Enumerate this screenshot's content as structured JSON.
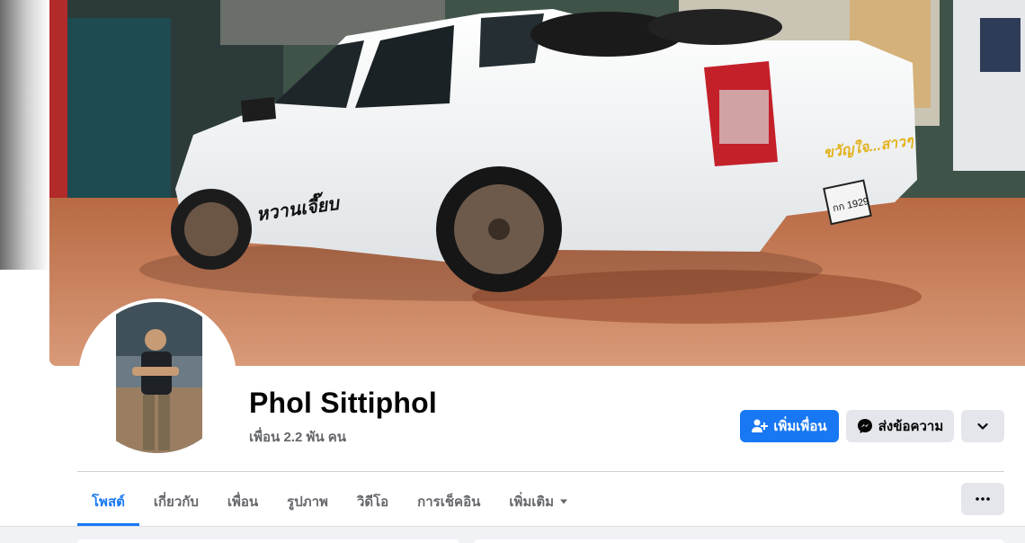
{
  "profile": {
    "name": "Phol Sittiphol",
    "friends_count": "เพื่อน 2.2 พัน คน"
  },
  "actions": {
    "add_friend": "เพิ่มเพื่อน",
    "message": "ส่งข้อความ"
  },
  "tabs": [
    {
      "label": "โพสต์",
      "active": true
    },
    {
      "label": "เกี่ยวกับ",
      "active": false
    },
    {
      "label": "เพื่อน",
      "active": false
    },
    {
      "label": "รูปภาพ",
      "active": false
    },
    {
      "label": "วิดีโอ",
      "active": false
    },
    {
      "label": "การเช็คอิน",
      "active": false
    },
    {
      "label": "เพิ่มเติม",
      "active": false
    }
  ],
  "cover": {
    "sticker_side": "หวานเจี๊ยบ",
    "sticker_tail": "ขวัญใจ...สาวๆ",
    "plate": "กก 1929"
  },
  "icons": {
    "add_friend": "person-plus-icon",
    "message": "messenger-icon",
    "more": "chevron-down-icon",
    "tab_more": "caret-down-icon",
    "dots": "ellipsis-icon"
  },
  "colors": {
    "accent": "#1877f2",
    "secondary_bg": "#e4e6eb",
    "muted_text": "#65676b"
  }
}
